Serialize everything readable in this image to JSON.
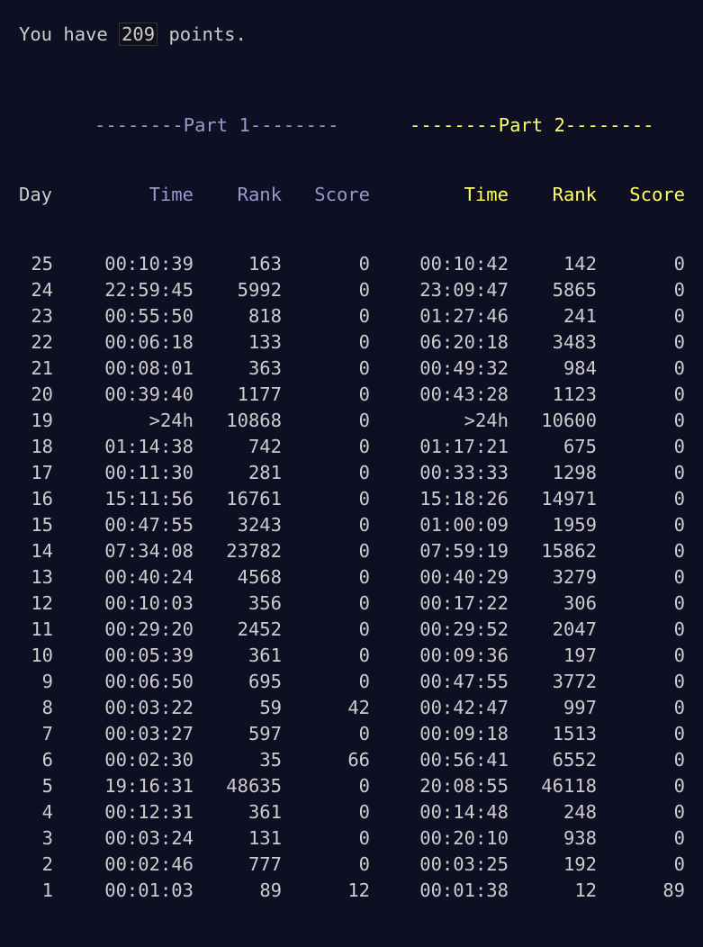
{
  "points_line": {
    "prefix": "You have ",
    "value": "209",
    "suffix": " points."
  },
  "header": {
    "part1_banner": "--------Part 1--------",
    "part2_banner": "--------Part 2--------",
    "day": "Day",
    "time": "Time",
    "rank": "Rank",
    "score": "Score"
  },
  "rows": [
    {
      "day": "25",
      "t1": "00:10:39",
      "r1": "163",
      "s1": "0",
      "t2": "00:10:42",
      "r2": "142",
      "s2": "0"
    },
    {
      "day": "24",
      "t1": "22:59:45",
      "r1": "5992",
      "s1": "0",
      "t2": "23:09:47",
      "r2": "5865",
      "s2": "0"
    },
    {
      "day": "23",
      "t1": "00:55:50",
      "r1": "818",
      "s1": "0",
      "t2": "01:27:46",
      "r2": "241",
      "s2": "0"
    },
    {
      "day": "22",
      "t1": "00:06:18",
      "r1": "133",
      "s1": "0",
      "t2": "06:20:18",
      "r2": "3483",
      "s2": "0"
    },
    {
      "day": "21",
      "t1": "00:08:01",
      "r1": "363",
      "s1": "0",
      "t2": "00:49:32",
      "r2": "984",
      "s2": "0"
    },
    {
      "day": "20",
      "t1": "00:39:40",
      "r1": "1177",
      "s1": "0",
      "t2": "00:43:28",
      "r2": "1123",
      "s2": "0"
    },
    {
      "day": "19",
      "t1": ">24h",
      "r1": "10868",
      "s1": "0",
      "t2": ">24h",
      "r2": "10600",
      "s2": "0"
    },
    {
      "day": "18",
      "t1": "01:14:38",
      "r1": "742",
      "s1": "0",
      "t2": "01:17:21",
      "r2": "675",
      "s2": "0"
    },
    {
      "day": "17",
      "t1": "00:11:30",
      "r1": "281",
      "s1": "0",
      "t2": "00:33:33",
      "r2": "1298",
      "s2": "0"
    },
    {
      "day": "16",
      "t1": "15:11:56",
      "r1": "16761",
      "s1": "0",
      "t2": "15:18:26",
      "r2": "14971",
      "s2": "0"
    },
    {
      "day": "15",
      "t1": "00:47:55",
      "r1": "3243",
      "s1": "0",
      "t2": "01:00:09",
      "r2": "1959",
      "s2": "0"
    },
    {
      "day": "14",
      "t1": "07:34:08",
      "r1": "23782",
      "s1": "0",
      "t2": "07:59:19",
      "r2": "15862",
      "s2": "0"
    },
    {
      "day": "13",
      "t1": "00:40:24",
      "r1": "4568",
      "s1": "0",
      "t2": "00:40:29",
      "r2": "3279",
      "s2": "0"
    },
    {
      "day": "12",
      "t1": "00:10:03",
      "r1": "356",
      "s1": "0",
      "t2": "00:17:22",
      "r2": "306",
      "s2": "0"
    },
    {
      "day": "11",
      "t1": "00:29:20",
      "r1": "2452",
      "s1": "0",
      "t2": "00:29:52",
      "r2": "2047",
      "s2": "0"
    },
    {
      "day": "10",
      "t1": "00:05:39",
      "r1": "361",
      "s1": "0",
      "t2": "00:09:36",
      "r2": "197",
      "s2": "0"
    },
    {
      "day": "9",
      "t1": "00:06:50",
      "r1": "695",
      "s1": "0",
      "t2": "00:47:55",
      "r2": "3772",
      "s2": "0"
    },
    {
      "day": "8",
      "t1": "00:03:22",
      "r1": "59",
      "s1": "42",
      "t2": "00:42:47",
      "r2": "997",
      "s2": "0"
    },
    {
      "day": "7",
      "t1": "00:03:27",
      "r1": "597",
      "s1": "0",
      "t2": "00:09:18",
      "r2": "1513",
      "s2": "0"
    },
    {
      "day": "6",
      "t1": "00:02:30",
      "r1": "35",
      "s1": "66",
      "t2": "00:56:41",
      "r2": "6552",
      "s2": "0"
    },
    {
      "day": "5",
      "t1": "19:16:31",
      "r1": "48635",
      "s1": "0",
      "t2": "20:08:55",
      "r2": "46118",
      "s2": "0"
    },
    {
      "day": "4",
      "t1": "00:12:31",
      "r1": "361",
      "s1": "0",
      "t2": "00:14:48",
      "r2": "248",
      "s2": "0"
    },
    {
      "day": "3",
      "t1": "00:03:24",
      "r1": "131",
      "s1": "0",
      "t2": "00:20:10",
      "r2": "938",
      "s2": "0"
    },
    {
      "day": "2",
      "t1": "00:02:46",
      "r1": "777",
      "s1": "0",
      "t2": "00:03:25",
      "r2": "192",
      "s2": "0"
    },
    {
      "day": "1",
      "t1": "00:01:03",
      "r1": "89",
      "s1": "12",
      "t2": "00:01:38",
      "r2": "12",
      "s2": "89"
    }
  ],
  "colors": {
    "background": "#0f0f23",
    "text": "#cccccc",
    "part1": "#9999cc",
    "part2": "#ffff66"
  }
}
